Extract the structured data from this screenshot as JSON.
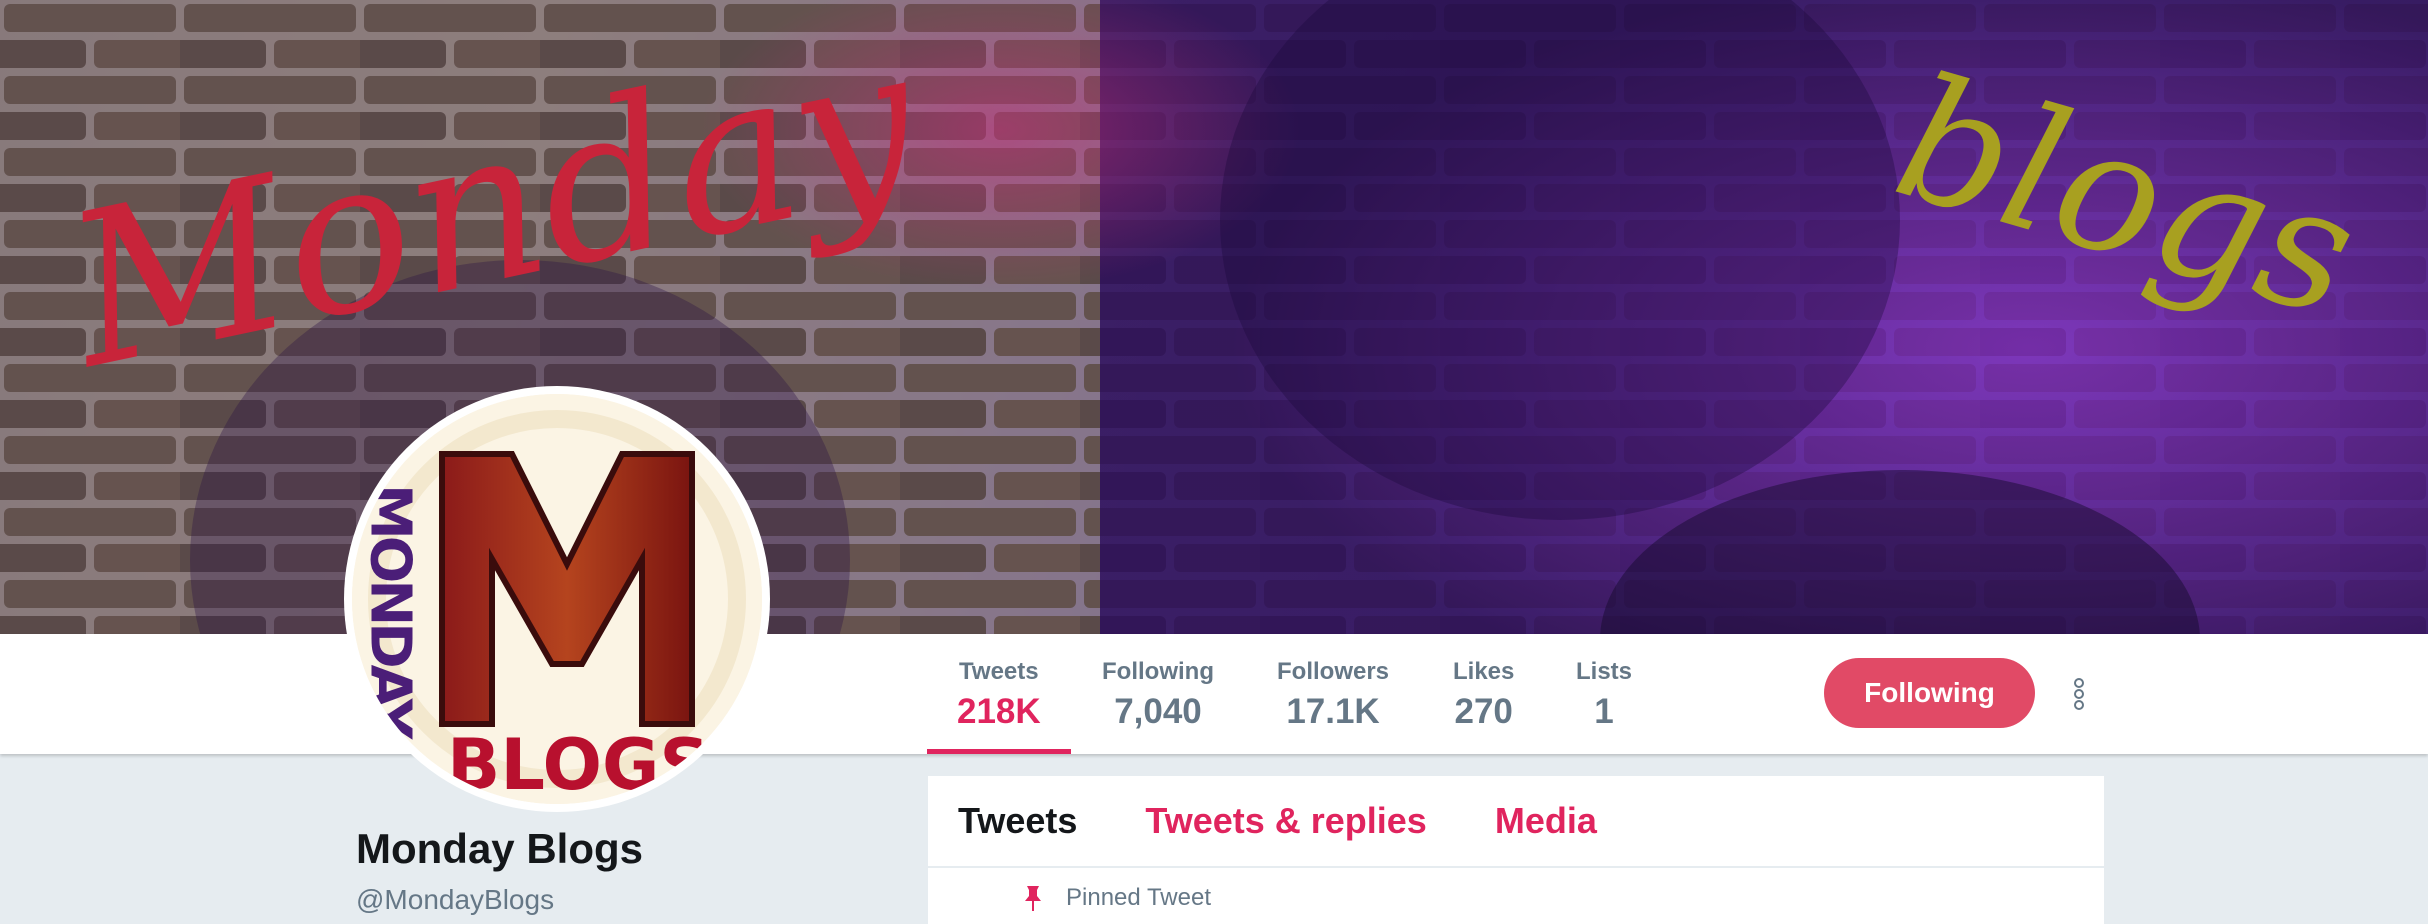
{
  "banner": {
    "script_left": "Monday",
    "script_right": "blogs"
  },
  "avatar": {
    "logo_letter": "M",
    "logo_side_text": "MONDAY",
    "logo_bottom_text": "BLOGS"
  },
  "stats": [
    {
      "label": "Tweets",
      "value": "218K"
    },
    {
      "label": "Following",
      "value": "7,040"
    },
    {
      "label": "Followers",
      "value": "17.1K"
    },
    {
      "label": "Likes",
      "value": "270"
    },
    {
      "label": "Lists",
      "value": "1"
    }
  ],
  "follow_button": {
    "label": "Following"
  },
  "profile": {
    "name": "Monday Blogs",
    "handle": "@MondayBlogs"
  },
  "timeline": {
    "tabs": [
      "Tweets",
      "Tweets & replies",
      "Media"
    ],
    "pinned_label": "Pinned Tweet"
  },
  "colors": {
    "accent": "#e0245e",
    "muted": "#657786",
    "text": "#14171a",
    "page_bg": "#e6ecf0"
  }
}
